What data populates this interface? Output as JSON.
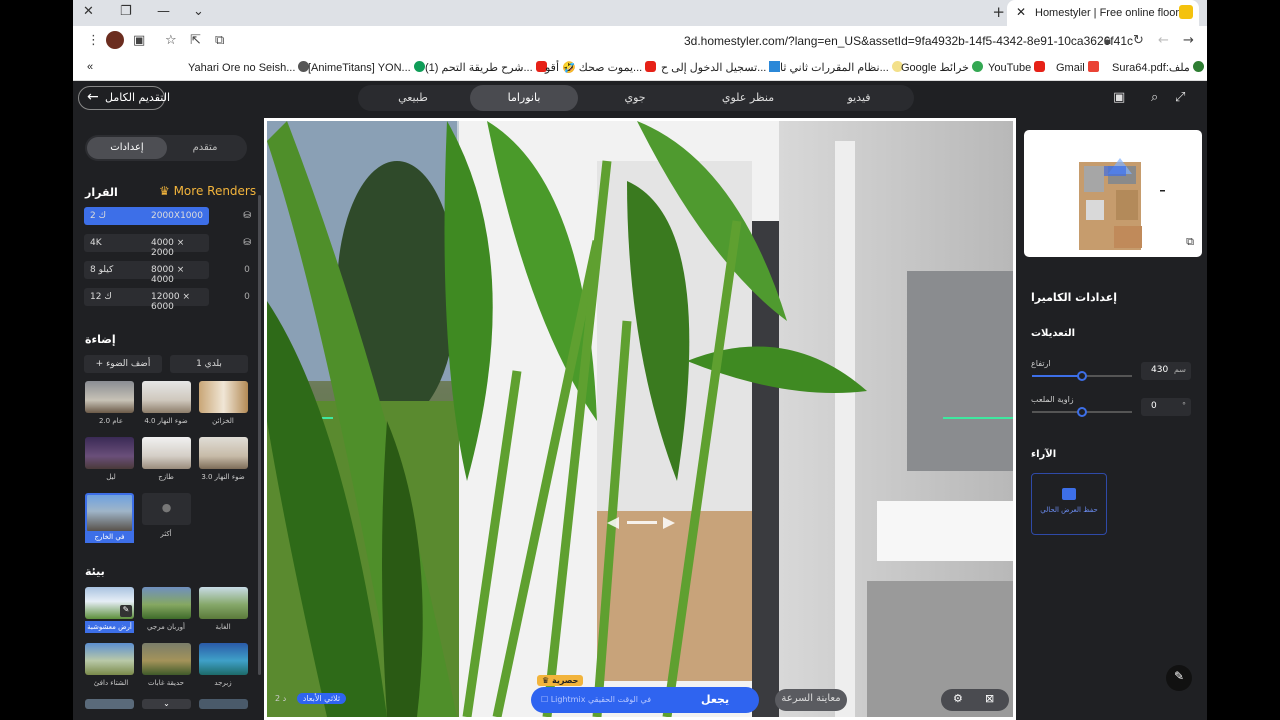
{
  "browser": {
    "tab_title": "Homestyler | Free online floor pl",
    "url": "3d.homestyler.com/?lang=en_US&assetId=9fa4932b-14f5-4342-8e91-10ca3626f41c",
    "bookmarks": [
      "Yahari Ore no Seish...",
      "[AnimeTitans] YON...",
      "(1) شرح طريقة التحم...",
      "يموت صحك 🤣 أقو...",
      "تسجيل الدخول إلى ح...",
      "نظام المقررات ثاني ثا...",
      "Google خرائط",
      "YouTube",
      "Gmail",
      "Sura64.pdf:ملف"
    ]
  },
  "topbar": {
    "back_label": "التقديم الكامل",
    "modes": [
      "طبيعي",
      "بانوراما",
      "جوي",
      "منظر علوي",
      "فيديو"
    ],
    "active_mode": "بانوراما"
  },
  "left": {
    "tabs": {
      "settings": "إعدادات",
      "advanced": "متقدم"
    },
    "resolution_title": "القرار",
    "more_renders": "More Renders",
    "resolutions": [
      {
        "size": "2000X1000",
        "label": "2 ك"
      },
      {
        "size": "4000 × 2000",
        "label": "4K"
      },
      {
        "size": "8000 × 4000",
        "label": "8 كيلو",
        "count": "0"
      },
      {
        "size": "12000 × 6000",
        "label": "12 ك",
        "count": "0"
      }
    ],
    "lighting_title": "إضاءة",
    "add_light": "أضف الضوء",
    "preset": "بلدي 1",
    "lights": [
      "عام 2.0",
      "ضوء النهار 4.0",
      "الخزائن",
      "ليل",
      "طازج",
      "ضوء النهار 3.0",
      "في الخارج",
      "أكثر"
    ],
    "env_title": "بيئة",
    "envs": [
      "أرض معشوشبة",
      "أوربان مرجي",
      "الغابة",
      "الشتاء دافئ",
      "حديقة غابات",
      "زبرجد"
    ]
  },
  "viewport": {
    "render_badge": "حصرية",
    "render_label": "يجعل",
    "realtime_label": "Lightmix في الوقت الحقيقي",
    "quick_preview": "معاينة السرعة",
    "toggle_3d": "ثلاثي الأبعاد",
    "toggle_2d": "2 د"
  },
  "right": {
    "camera_title": "إعدادات الكاميرا",
    "adjust_title": "التعديلات",
    "height_label": "ارتفاع",
    "height_value": "430",
    "height_unit": "سم",
    "pitch_label": "زاوية الملعب",
    "pitch_value": "0",
    "pitch_unit": "°",
    "views_title": "الآراء",
    "save_view": "حفظ العرض الحالي"
  },
  "colors": {
    "accent": "#3d6fe8",
    "gold": "#f2b43c",
    "bg": "#1f2023"
  }
}
